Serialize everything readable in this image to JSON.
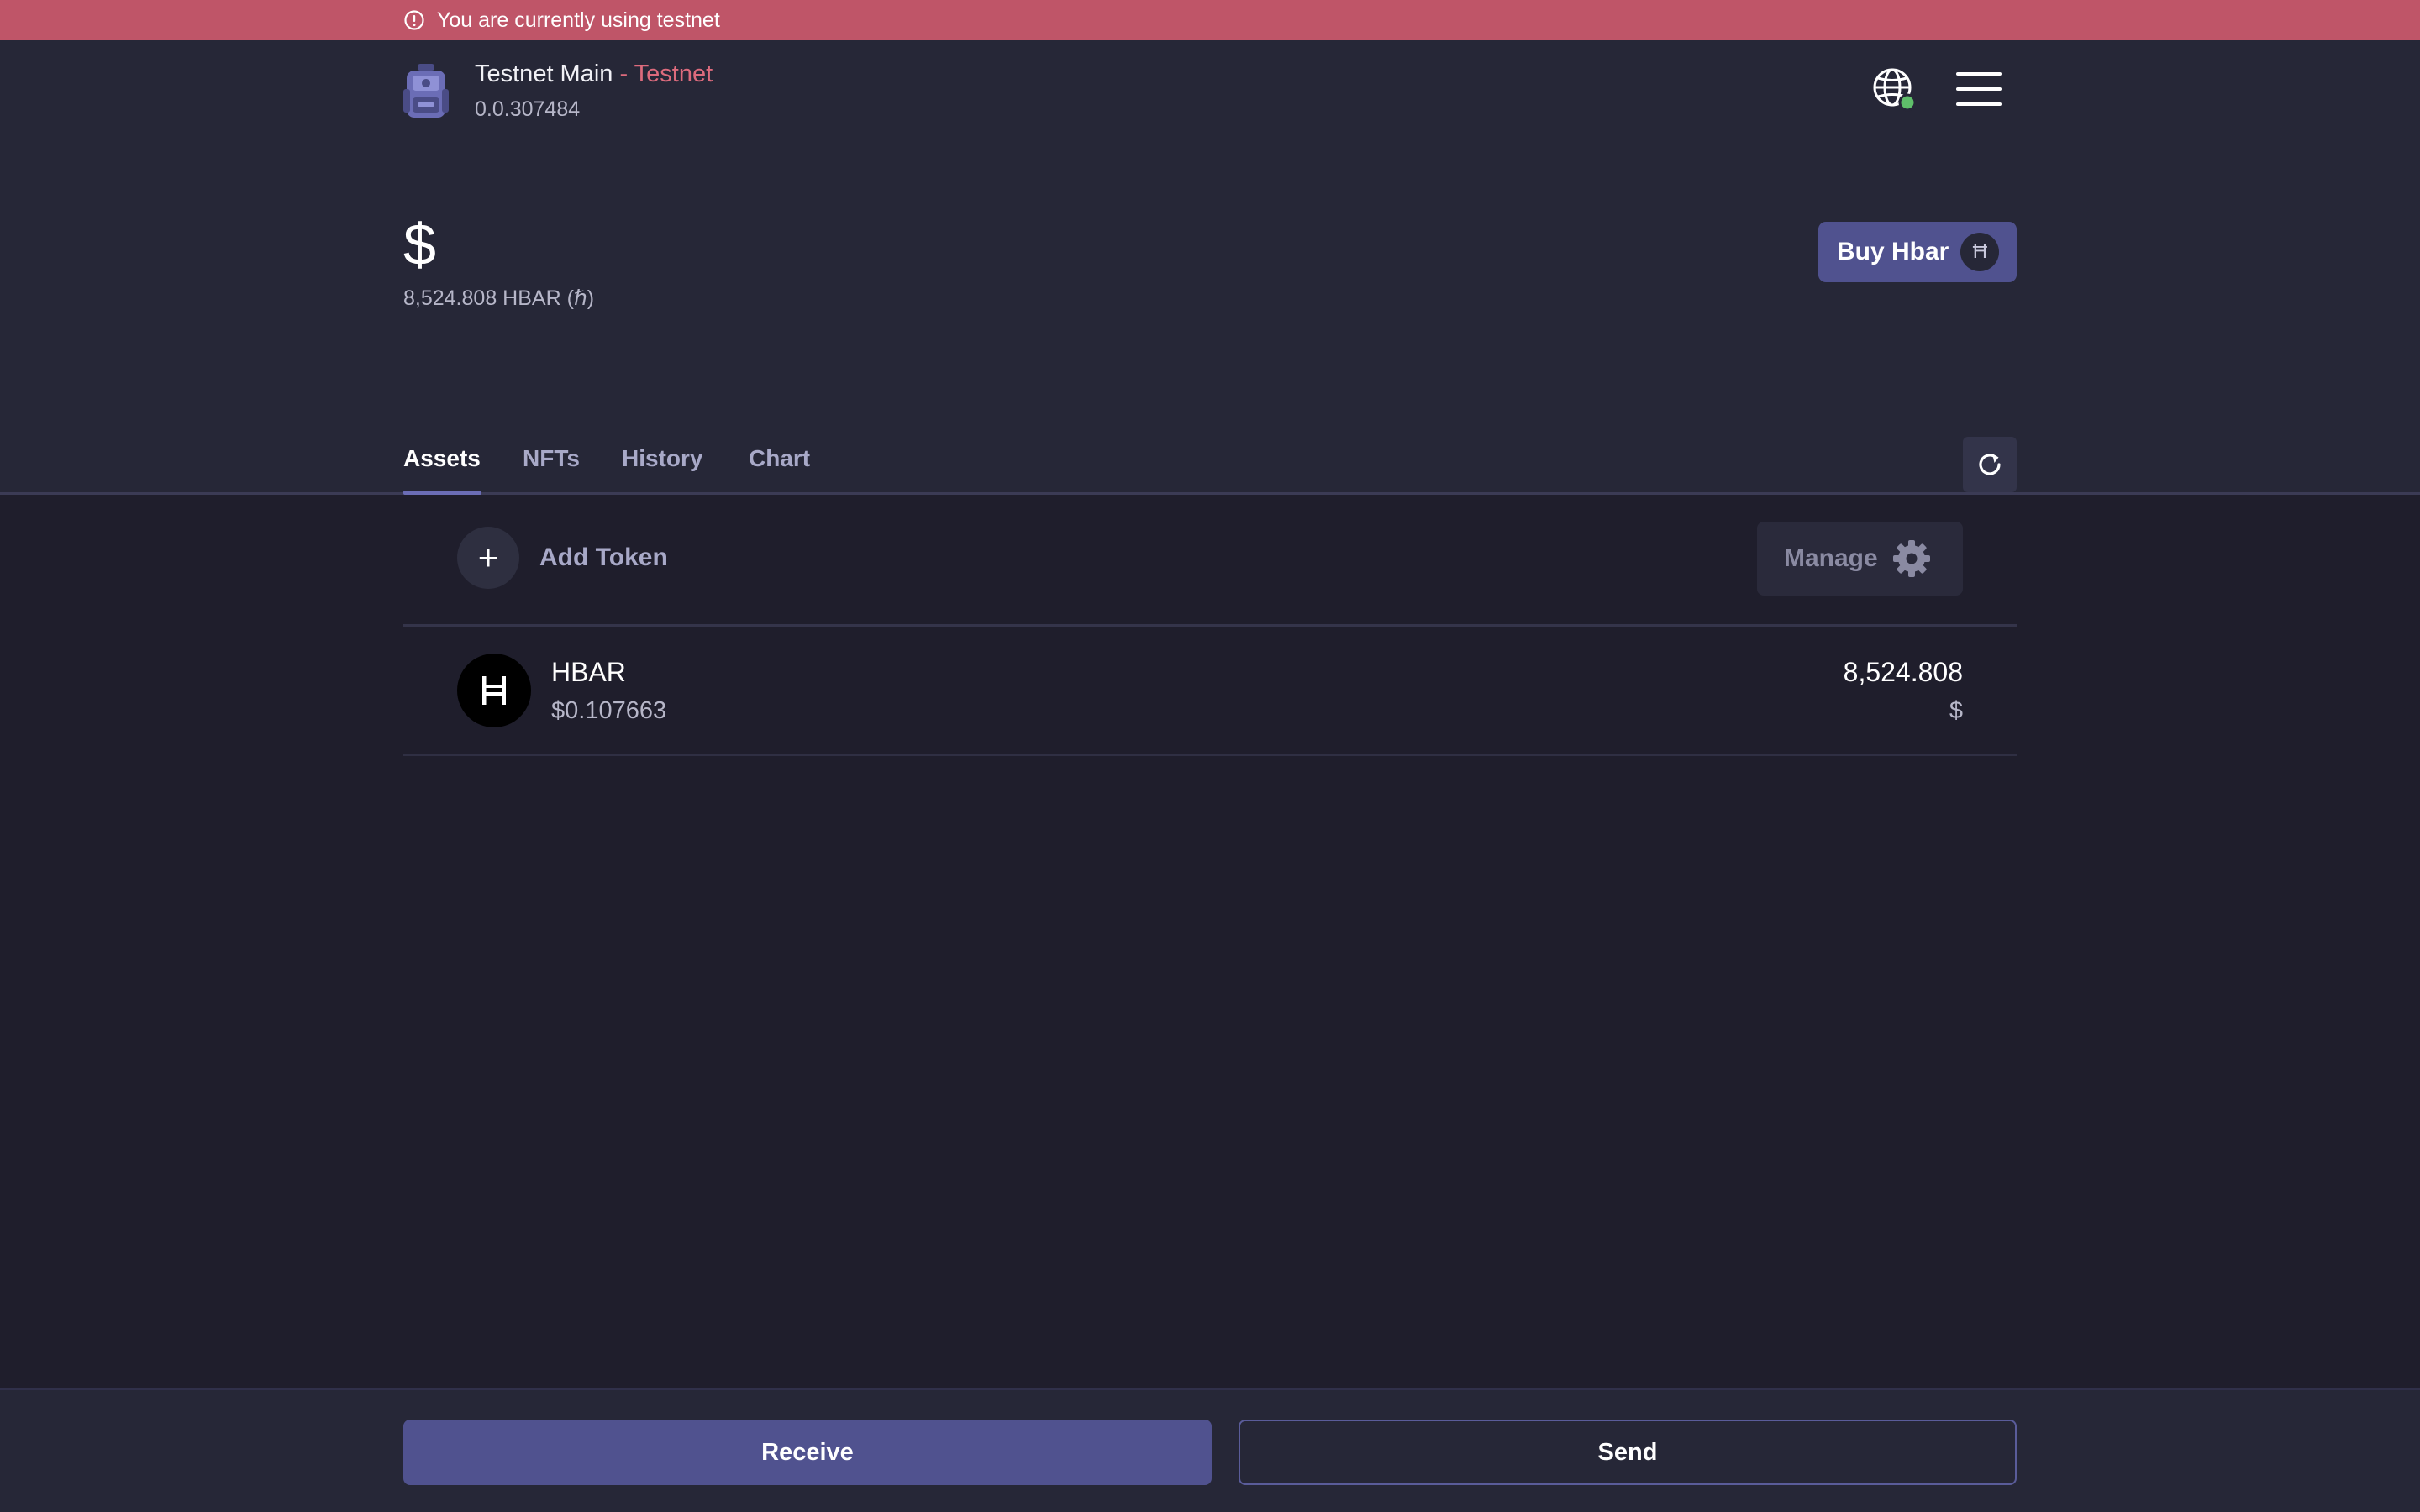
{
  "banner": {
    "text": "You are currently using testnet",
    "icon": "alert-circle-icon"
  },
  "account": {
    "name": "Testnet Main",
    "network_label": " - Testnet",
    "account_id": "0.0.307484"
  },
  "header_icons": [
    "globe-icon",
    "hamburger-menu-icon"
  ],
  "balance": {
    "fiat": "$",
    "hbar": "8,524.808 HBAR (ℏ)"
  },
  "buy_button": {
    "label": "Buy Hbar",
    "icon_glyph": "Ħ"
  },
  "tabs": [
    {
      "label": "Assets",
      "active": true
    },
    {
      "label": "NFTs",
      "active": false
    },
    {
      "label": "History",
      "active": false
    },
    {
      "label": "Chart",
      "active": false
    }
  ],
  "assets_panel": {
    "add_token_label": "Add Token",
    "add_token_glyph": "+",
    "manage_label": "Manage"
  },
  "assets": [
    {
      "name": "HBAR",
      "price": "$0.107663",
      "balance": "8,524.808",
      "value": "$"
    }
  ],
  "footer": {
    "receive_label": "Receive",
    "send_label": "Send"
  },
  "colors": {
    "banner": "#bf5568",
    "accent": "#50528f",
    "network_text": "#dd6b7d",
    "online_dot": "#5fbf6a",
    "background": "#1f1e2c",
    "header_background": "#262737"
  }
}
